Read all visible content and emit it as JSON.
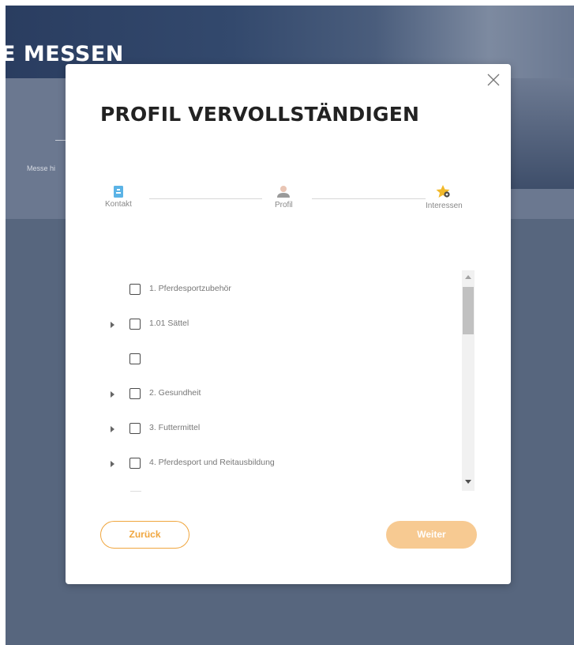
{
  "background": {
    "hero_title": "E MESSEN",
    "tab_text": "Messe hi"
  },
  "modal": {
    "title": "PROFIL VERVOLLSTÄNDIGEN",
    "close_icon": "close-icon",
    "steps": [
      {
        "label": "Kontakt",
        "icon": "contact-card-icon",
        "state": "done"
      },
      {
        "label": "Profil",
        "icon": "user-icon",
        "state": "done"
      },
      {
        "label": "Interessen",
        "icon": "star-icon",
        "state": "active"
      }
    ],
    "interests": [
      {
        "label": "1. Pferdesportzubehör",
        "expandable": false,
        "checked": false
      },
      {
        "label": "1.01 Sättel",
        "expandable": true,
        "checked": false
      },
      {
        "label": "",
        "expandable": false,
        "checked": false
      },
      {
        "label": "2. Gesundheit",
        "expandable": true,
        "checked": false
      },
      {
        "label": "3. Futtermittel",
        "expandable": true,
        "checked": false
      },
      {
        "label": "4. Pferdesport und Reitausbildung",
        "expandable": true,
        "checked": false
      }
    ],
    "scroll_position": 0.0,
    "buttons": {
      "back_label": "Zurück",
      "next_label": "Weiter",
      "next_enabled": false
    }
  },
  "colors": {
    "accent": "#f0a63e",
    "accent_disabled": "#f7ca92",
    "overlay": "#57667e",
    "step_blue": "#5bb3e6",
    "step_star": "#f2b92a"
  }
}
